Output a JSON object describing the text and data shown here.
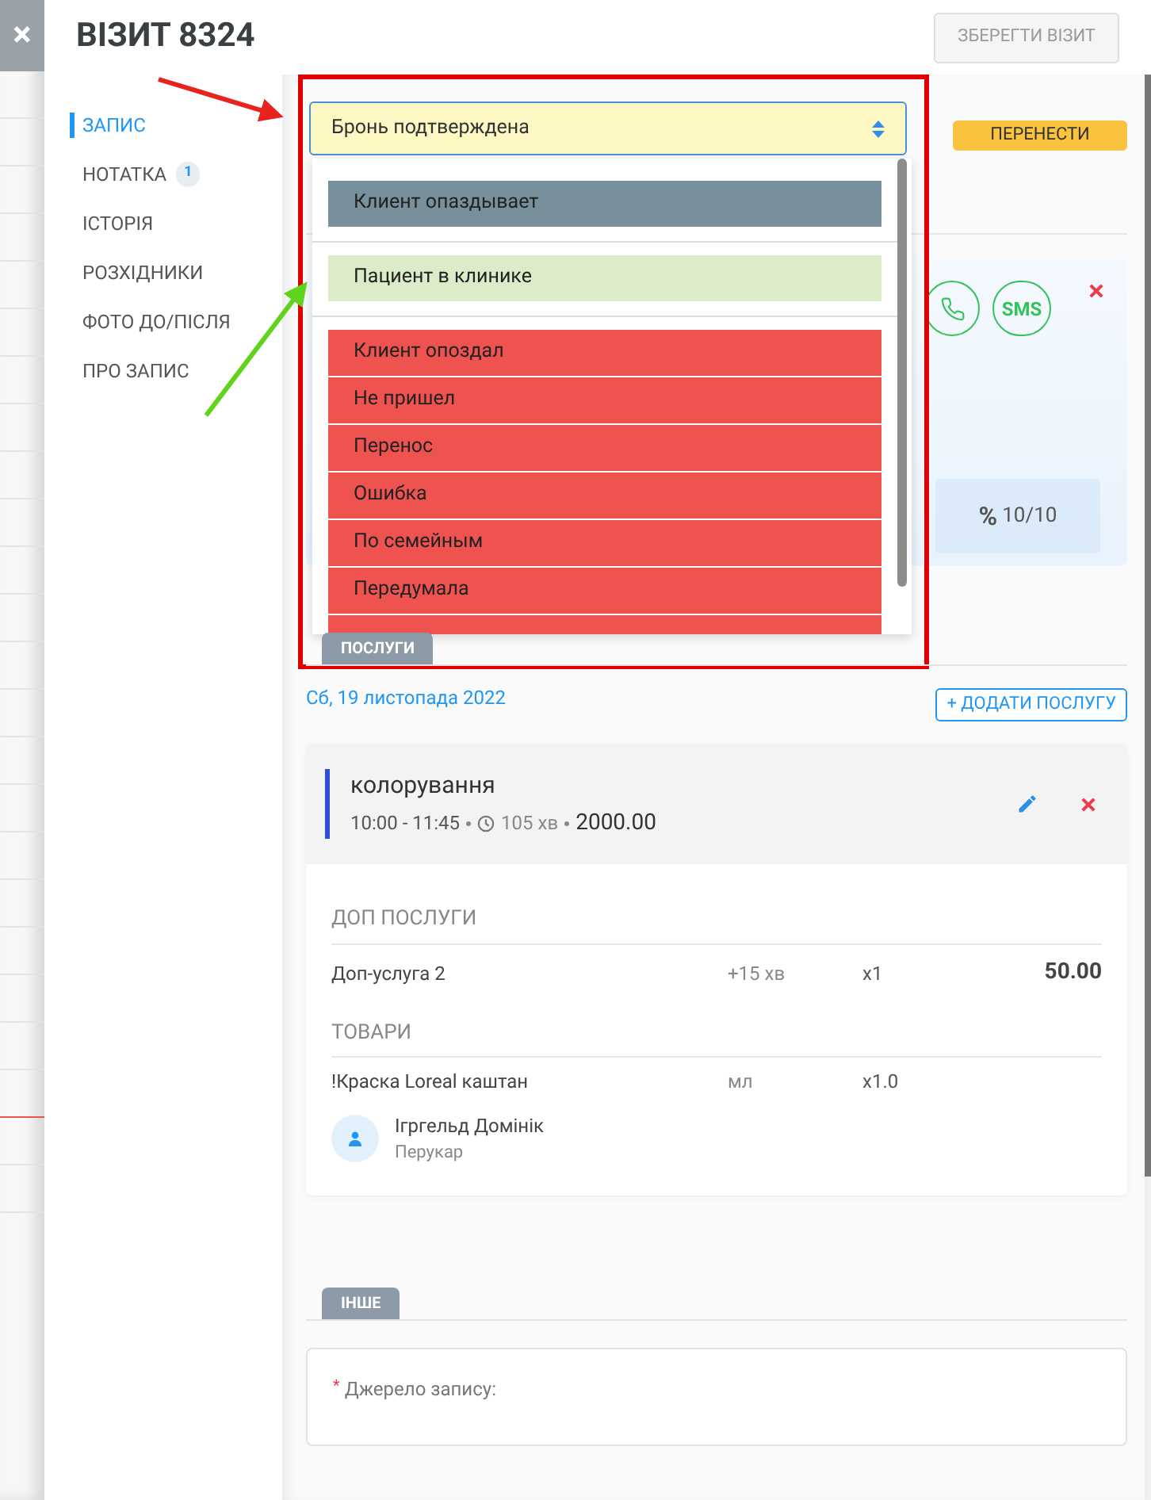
{
  "close_button": {
    "label": "×"
  },
  "header": {
    "title": "ВІЗИТ 8324",
    "save_button": "ЗБЕРЕГТИ ВІЗИТ"
  },
  "sidebar": {
    "items": [
      {
        "label": "ЗАПИС",
        "selected": true
      },
      {
        "label": "НОТАТКА",
        "selected": false,
        "badge": "1"
      },
      {
        "label": "ІСТОРІЯ",
        "selected": false
      },
      {
        "label": "РОЗХІДНИКИ",
        "selected": false
      },
      {
        "label": "ФОТО ДО/ПІСЛЯ",
        "selected": false
      },
      {
        "label": "ПРО ЗАПИС",
        "selected": false
      }
    ]
  },
  "status_select": {
    "value": "Бронь подтверждена",
    "option_groups": [
      {
        "options": [
          {
            "label": "Клиент опаздывает",
            "color": "#78909c"
          }
        ]
      },
      {
        "options": [
          {
            "label": "Пациент в клинике",
            "color": "#dcebc8"
          }
        ]
      },
      {
        "options": [
          {
            "label": "Клиент опоздал",
            "color": "#ef5350"
          },
          {
            "label": "Не пришел",
            "color": "#ef5350"
          },
          {
            "label": "Перенос",
            "color": "#ef5350"
          },
          {
            "label": "Ошибка",
            "color": "#ef5350"
          },
          {
            "label": "По семейным",
            "color": "#ef5350"
          },
          {
            "label": "Передумала",
            "color": "#ef5350"
          }
        ]
      }
    ]
  },
  "reschedule_button": "ПЕРЕНЕСТИ",
  "client_card": {
    "sms_button": "SMS",
    "discount_symbol": "%",
    "discount": "10/10"
  },
  "services": {
    "tab": "ПОСЛУГИ",
    "date": "Сб, 19 листопада 2022",
    "add_button": "+ ДОДАТИ ПОСЛУГУ",
    "service": {
      "name": "колорування",
      "time": "10:00 - 11:45",
      "duration": "105 хв",
      "price": "2000.00",
      "extras_title": "ДОП ПОСЛУГИ",
      "extras": [
        {
          "name": "Доп-услуга 2",
          "time": "+15 хв",
          "qty": "x1",
          "price": "50.00"
        }
      ],
      "goods_title": "ТОВАРИ",
      "goods": [
        {
          "name": "!Краска Loreal каштан",
          "unit": "мл",
          "qty": "x1.0"
        }
      ],
      "staff": {
        "name": "Ігргельд Домінік",
        "role": "Перукар"
      }
    }
  },
  "other": {
    "tab": "ІНШЕ",
    "required_mark": "*",
    "source_label": "Джерело запису:"
  }
}
